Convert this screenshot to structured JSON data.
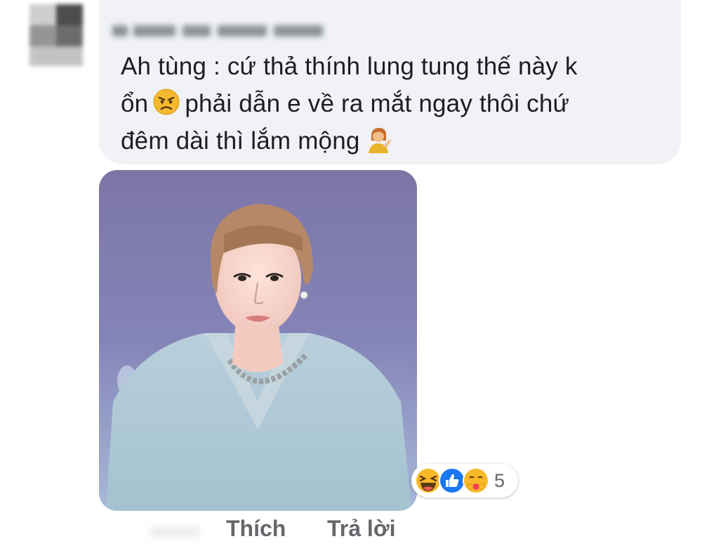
{
  "comment": {
    "line1": "Ah tùng : cứ thả thính lung tung thế này k",
    "line2_a": "ổn",
    "line2_b": "phải dẫn e về ra mắt ngay thôi chứ",
    "line3": "đêm dài thì lắm mộng",
    "emoji_1": "angry-face-icon",
    "emoji_2": "person-tipping-hand-icon"
  },
  "reactions": {
    "icons": [
      "haha-reaction-icon",
      "like-reaction-icon",
      "care-reaction-icon"
    ],
    "count": "5"
  },
  "actions": {
    "like_label": "Thích",
    "reply_label": "Trả lời"
  },
  "colors": {
    "bubble": "#f0f2f5",
    "text": "#1c1e21",
    "meta": "#65676b",
    "like_blue": "#1877f2",
    "haha_yellow": "#f7b928"
  }
}
